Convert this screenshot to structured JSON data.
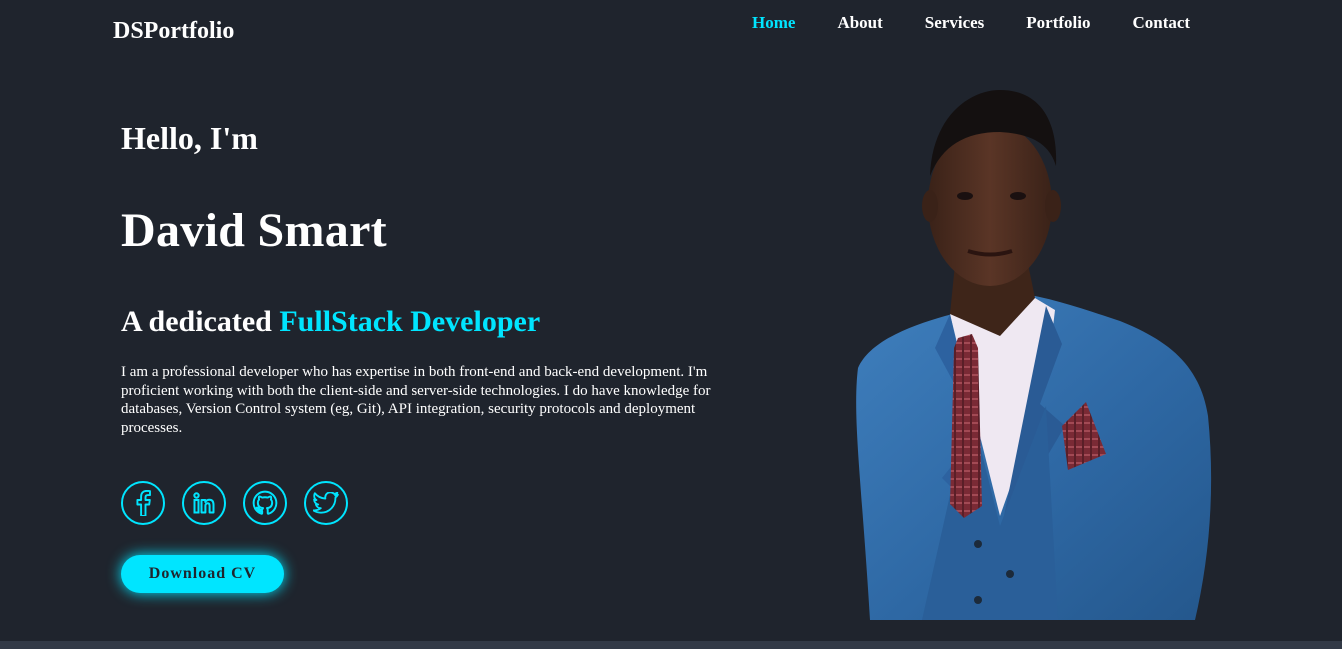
{
  "header": {
    "logo": "DSPortfolio",
    "nav": [
      {
        "label": "Home",
        "active": true
      },
      {
        "label": "About",
        "active": false
      },
      {
        "label": "Services",
        "active": false
      },
      {
        "label": "Portfolio",
        "active": false
      },
      {
        "label": "Contact",
        "active": false
      }
    ]
  },
  "hero": {
    "greeting": "Hello, I'm",
    "name": "David Smart",
    "tagline_prefix": "A dedicated ",
    "tagline_accent": "FullStack Developer",
    "bio": "I am a professional developer who has expertise in both front-end and back-end development. I'm proficient working with both the client-side and server-side technologies. I do have knowledge for databases, Version Control system (eg, Git), API integration, security protocols and deployment processes.",
    "socials": [
      {
        "icon": "facebook-icon"
      },
      {
        "icon": "linkedin-icon"
      },
      {
        "icon": "github-icon"
      },
      {
        "icon": "twitter-icon"
      }
    ],
    "cta_label": "Download CV"
  },
  "colors": {
    "background": "#1f242d",
    "accent": "#00e5ff",
    "text": "#ffffff",
    "footer_strip": "#323946"
  }
}
